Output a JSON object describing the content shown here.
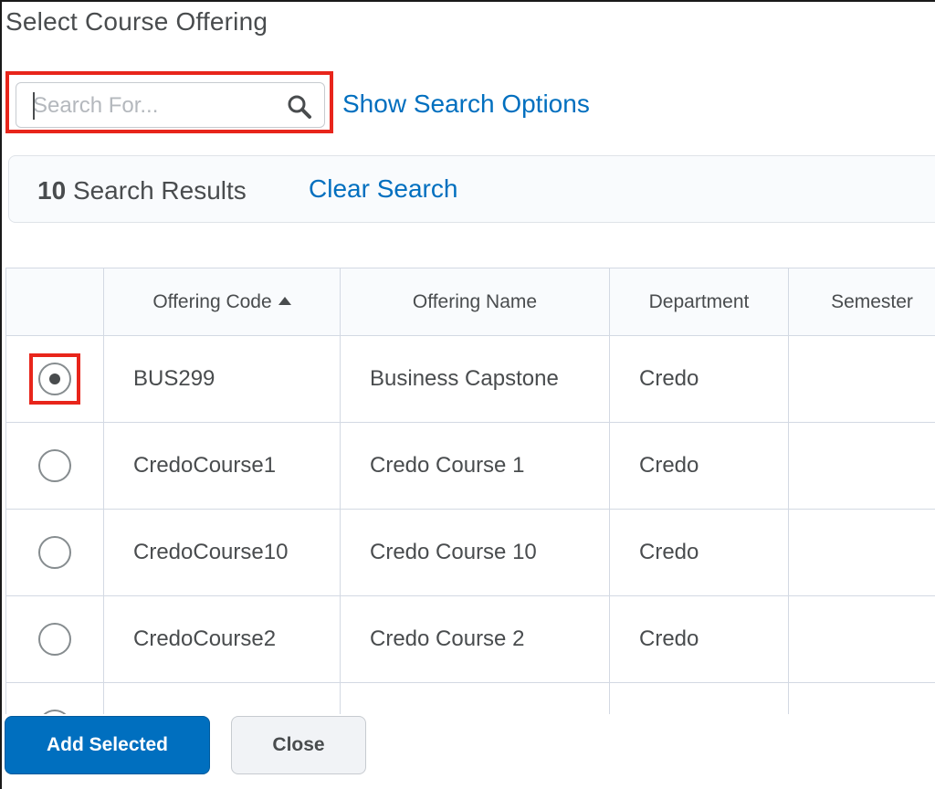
{
  "dialog": {
    "title": "Select Course Offering"
  },
  "search": {
    "placeholder": "Search For...",
    "value": "",
    "show_options_label": "Show Search Options"
  },
  "results": {
    "count": "10",
    "label": "Search Results",
    "clear_label": "Clear Search"
  },
  "table": {
    "headers": [
      "Offering Code",
      "Offering Name",
      "Department",
      "Semester"
    ],
    "sort": {
      "column": "Offering Code",
      "direction": "ascending"
    },
    "rows": [
      {
        "selected": true,
        "code": "BUS299",
        "name": "Business Capstone",
        "department": "Credo",
        "semester": ""
      },
      {
        "selected": false,
        "code": "CredoCourse1",
        "name": "Credo Course 1",
        "department": "Credo",
        "semester": ""
      },
      {
        "selected": false,
        "code": "CredoCourse10",
        "name": "Credo Course 10",
        "department": "Credo",
        "semester": ""
      },
      {
        "selected": false,
        "code": "CredoCourse2",
        "name": "Credo Course 2",
        "department": "Credo",
        "semester": ""
      },
      {
        "selected": false,
        "code": "",
        "name": "",
        "department": "",
        "semester": ""
      }
    ]
  },
  "footer": {
    "add_label": "Add Selected",
    "close_label": "Close"
  },
  "colors": {
    "accent": "#006fbf",
    "highlight": "#e8251b",
    "text": "#494c4e"
  },
  "icons": {
    "search": "search-icon",
    "sort": "sort-ascending-icon"
  }
}
